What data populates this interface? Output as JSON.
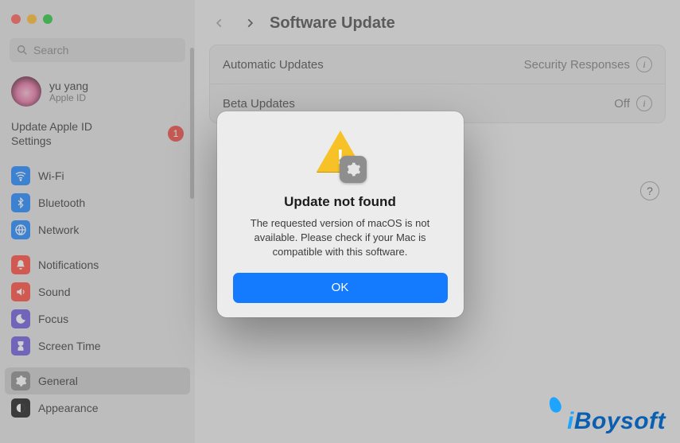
{
  "window": {
    "search_placeholder": "Search"
  },
  "user": {
    "name": "yu yang",
    "subtitle": "Apple ID"
  },
  "apple_id_notice": {
    "label": "Update Apple ID Settings",
    "badge": "1"
  },
  "sidebar_groups": [
    {
      "items": [
        {
          "key": "wifi",
          "label": "Wi-Fi"
        },
        {
          "key": "bt",
          "label": "Bluetooth"
        },
        {
          "key": "net",
          "label": "Network"
        }
      ]
    },
    {
      "items": [
        {
          "key": "notif",
          "label": "Notifications"
        },
        {
          "key": "sound",
          "label": "Sound"
        },
        {
          "key": "focus",
          "label": "Focus"
        },
        {
          "key": "screen",
          "label": "Screen Time"
        }
      ]
    },
    {
      "items": [
        {
          "key": "general",
          "label": "General"
        },
        {
          "key": "appear",
          "label": "Appearance"
        }
      ]
    }
  ],
  "main": {
    "title": "Software Update",
    "rows": [
      {
        "label": "Automatic Updates",
        "value": "Security Responses"
      },
      {
        "label": "Beta Updates",
        "value": "Off"
      }
    ],
    "help": "?"
  },
  "modal": {
    "title": "Update not found",
    "body": "The requested version of macOS is not available. Please check if your Mac is compatible with this software.",
    "ok": "OK"
  },
  "watermark": {
    "text_i": "i",
    "text_rest": "Boysoft"
  }
}
